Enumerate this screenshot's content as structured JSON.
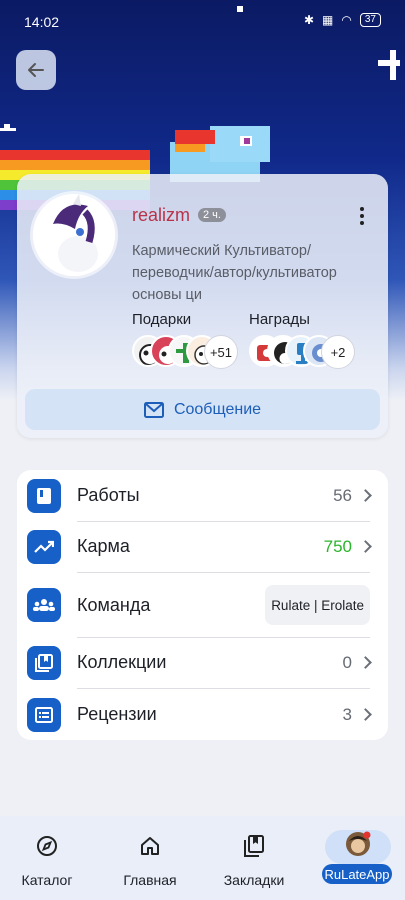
{
  "status_bar": {
    "time": "14:02",
    "battery": "37"
  },
  "profile": {
    "username": "realizm",
    "time_ago": "2 ч.",
    "bio": "Кармический Культиватор/ переводчик/автор/культиватор основы ци",
    "gifts_label": "Подарки",
    "gifts_more": "+51",
    "awards_label": "Награды",
    "awards_more": "+2",
    "message_label": "Сообщение"
  },
  "menu": {
    "works": {
      "label": "Работы",
      "value": "56"
    },
    "karma": {
      "label": "Карма",
      "value": "750"
    },
    "team": {
      "label": "Команда",
      "value": "Rulate | Erolate"
    },
    "collections": {
      "label": "Коллекции",
      "value": "0"
    },
    "reviews": {
      "label": "Рецензии",
      "value": "3"
    }
  },
  "nav": {
    "catalog": "Каталог",
    "home": "Главная",
    "bookmarks": "Закладки",
    "app": "RuLateApp"
  },
  "colors": {
    "accent": "#1660c8",
    "karma_green": "#2bb52b",
    "username": "#b8334a"
  }
}
